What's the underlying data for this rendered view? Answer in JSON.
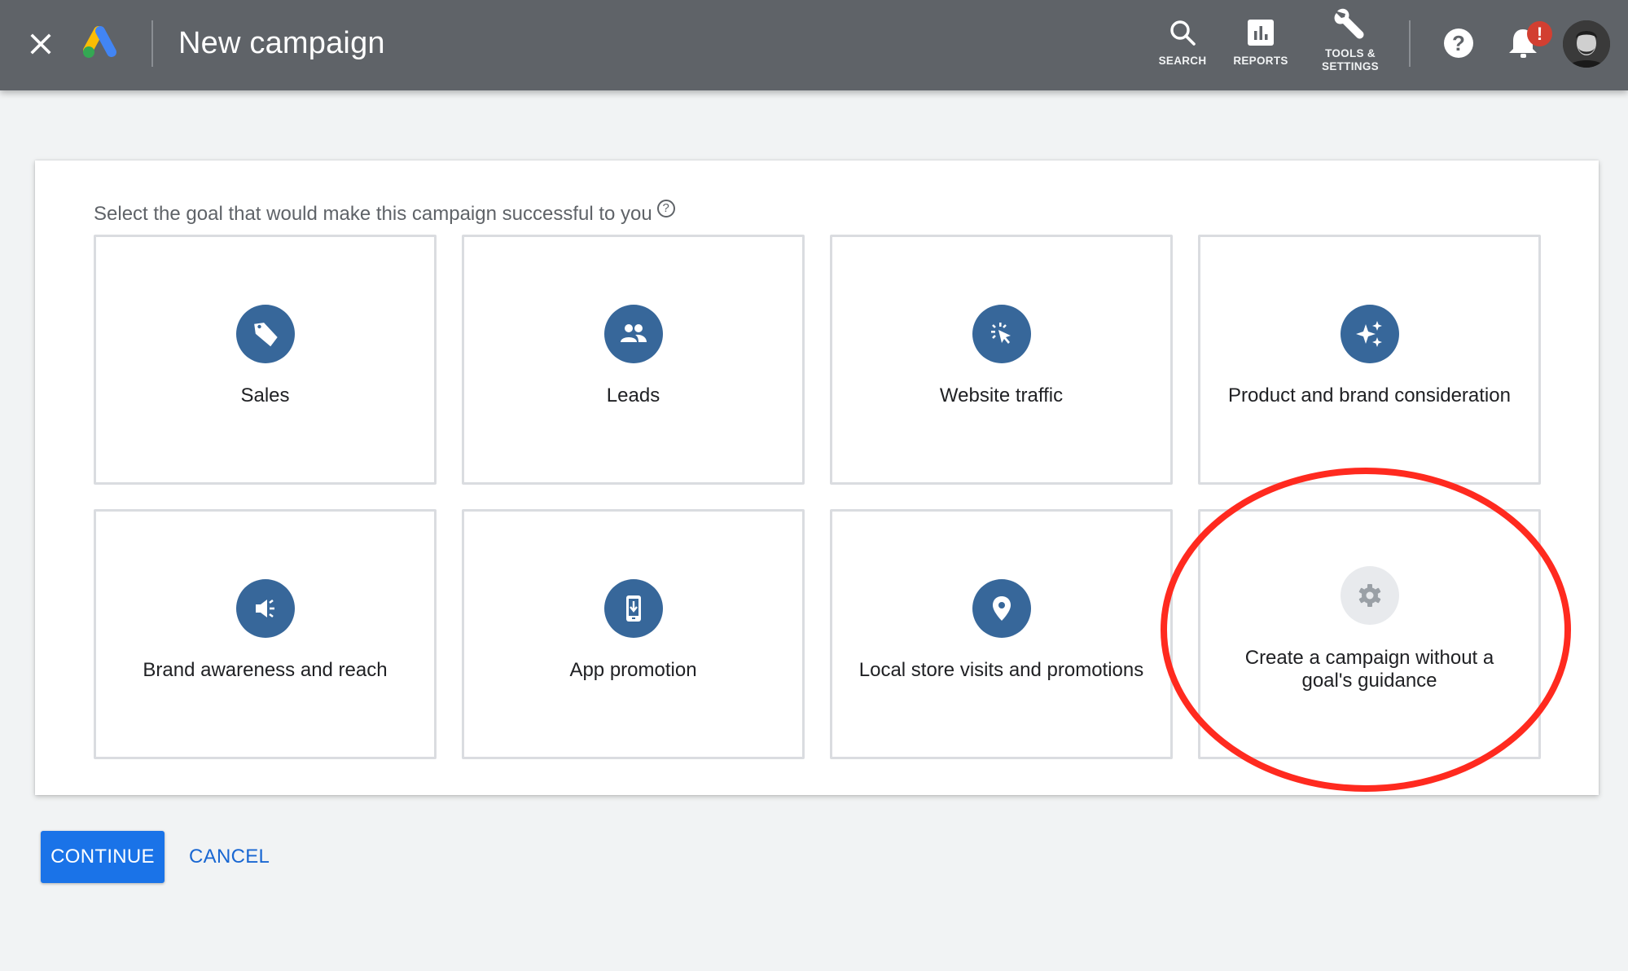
{
  "header": {
    "title": "New campaign",
    "close_icon": "close-icon",
    "logo": "google-ads-logo",
    "nav": [
      {
        "label": "SEARCH",
        "icon": "search-icon"
      },
      {
        "label": "REPORTS",
        "icon": "reports-icon"
      },
      {
        "label_line1": "TOOLS &",
        "label_line2": "SETTINGS",
        "icon": "wrench-icon"
      }
    ],
    "help_icon": "help-icon",
    "notifications": {
      "icon": "bell-icon",
      "badge": "!"
    },
    "avatar": "user-avatar"
  },
  "main": {
    "prompt": "Select the goal that would make this campaign successful to you",
    "prompt_help": "?",
    "goals": [
      {
        "label": "Sales",
        "icon": "tag-icon"
      },
      {
        "label": "Leads",
        "icon": "people-icon"
      },
      {
        "label": "Website traffic",
        "icon": "cursor-click-icon"
      },
      {
        "label": "Product and brand consideration",
        "icon": "sparkle-icon"
      },
      {
        "label": "Brand awareness and reach",
        "icon": "megaphone-icon"
      },
      {
        "label": "App promotion",
        "icon": "phone-download-icon"
      },
      {
        "label": "Local store visits and promotions",
        "icon": "location-pin-icon"
      },
      {
        "label_line1": "Create a campaign without a",
        "label_line2": "goal's guidance",
        "icon": "gear-icon"
      }
    ],
    "annotation": {
      "shape": "ellipse",
      "color": "#ff2a1f",
      "target": "Create a campaign without a goal's guidance"
    }
  },
  "actions": {
    "continue": "CONTINUE",
    "cancel": "CANCEL"
  },
  "colors": {
    "header_bg": "#5f6368",
    "goal_icon": "#37679a",
    "primary_button": "#1a73e8",
    "link": "#1967d2",
    "badge": "#d23f31"
  }
}
